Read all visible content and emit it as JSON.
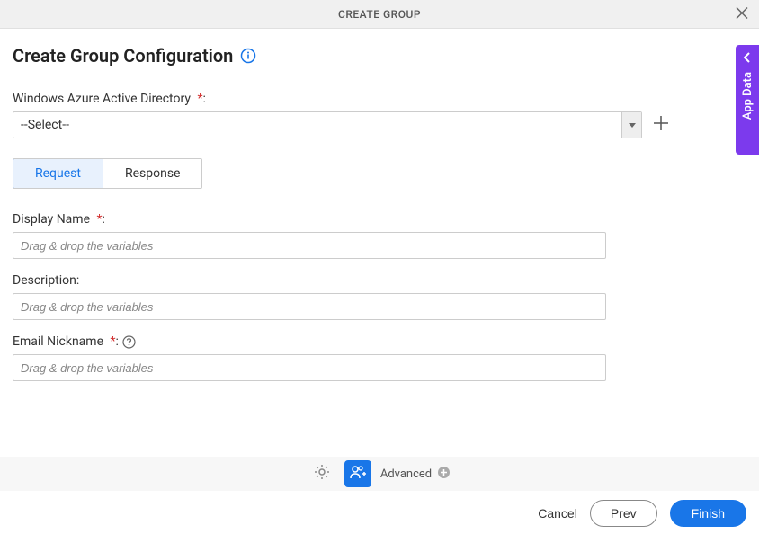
{
  "header": {
    "title": "CREATE GROUP"
  },
  "page": {
    "title": "Create Group Configuration"
  },
  "directory": {
    "label": "Windows Azure Active Directory",
    "value": "--Select--"
  },
  "tabs": {
    "request": "Request",
    "response": "Response"
  },
  "fields": {
    "displayName": {
      "label": "Display Name",
      "placeholder": "Drag & drop the variables"
    },
    "description": {
      "label": "Description:",
      "placeholder": "Drag & drop the variables"
    },
    "emailNickname": {
      "label": "Email Nickname",
      "placeholder": "Drag & drop the variables"
    }
  },
  "toolbar": {
    "advanced": "Advanced"
  },
  "sidePanel": {
    "label": "App Data"
  },
  "footer": {
    "cancel": "Cancel",
    "prev": "Prev",
    "finish": "Finish"
  }
}
